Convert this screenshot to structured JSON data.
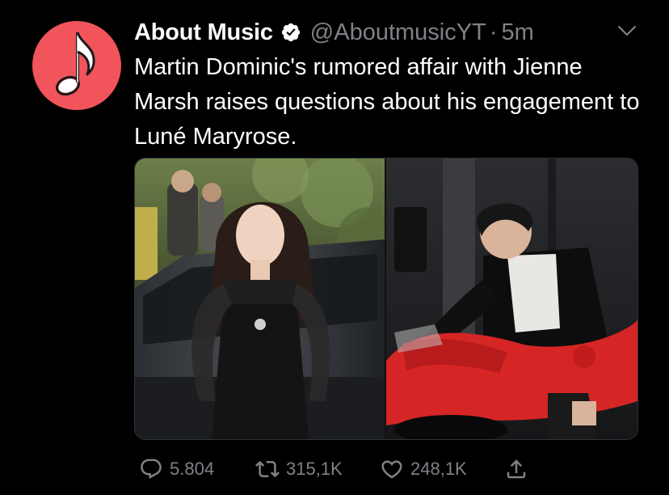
{
  "tweet": {
    "author": {
      "display_name": "About Music",
      "handle": "@AboutmusicYT",
      "separator": "·",
      "time": "5m",
      "verified": true,
      "avatar_icon": "music-note-icon",
      "avatar_color": "#f2545b"
    },
    "text": "Martin Dominic's rumored affair with Jienne Marsh raises questions about his engagement to Luné Maryrose.",
    "media": [
      {
        "type": "photo",
        "icon": "photo-woman-black-dress"
      },
      {
        "type": "photo",
        "icon": "photo-man-red-motorcycle"
      }
    ],
    "actions": {
      "replies": "5.804",
      "retweets": "315,1K",
      "likes": "248,1K"
    }
  },
  "colors": {
    "background": "#000000",
    "text": "#ffffff",
    "secondary": "#7e8287",
    "verified_badge": "#ffffff"
  }
}
